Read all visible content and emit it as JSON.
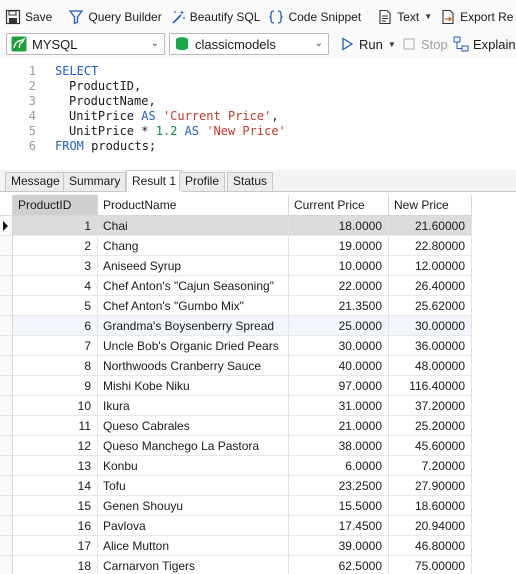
{
  "toolbar": {
    "save": "Save",
    "query_builder": "Query Builder",
    "beautify_sql": "Beautify SQL",
    "code_snippet": "Code Snippet",
    "text": "Text",
    "export": "Export Re"
  },
  "connection": {
    "server": "MYSQL",
    "database": "classicmodels",
    "run": "Run",
    "stop": "Stop",
    "explain": "Explain"
  },
  "editor": {
    "lines": [
      "1",
      "2",
      "3",
      "4",
      "5",
      "6"
    ],
    "l1": "SELECT",
    "l2": "ProductID,",
    "l3": "ProductName,",
    "l4_a": "UnitPrice ",
    "l4_b": "AS",
    "l4_c": "'Current Price'",
    "l4_d": ",",
    "l5_a": "UnitPrice * ",
    "l5_b": "1.2",
    "l5_c": "AS",
    "l5_d": "'New Price'",
    "l6_a": "FROM",
    "l6_b": " products;"
  },
  "tabs": {
    "message": "Message",
    "summary": "Summary",
    "result": "Result 1",
    "profile": "Profile",
    "status": "Status"
  },
  "results": {
    "columns": [
      "ProductID",
      "ProductName",
      "Current Price",
      "New Price"
    ],
    "rows": [
      [
        "1",
        "Chai",
        "18.0000",
        "21.60000"
      ],
      [
        "2",
        "Chang",
        "19.0000",
        "22.80000"
      ],
      [
        "3",
        "Aniseed Syrup",
        "10.0000",
        "12.00000"
      ],
      [
        "4",
        "Chef Anton's \"Cajun Seasoning\"",
        "22.0000",
        "26.40000"
      ],
      [
        "5",
        "Chef Anton's \"Gumbo Mix\"",
        "21.3500",
        "25.62000"
      ],
      [
        "6",
        "Grandma's Boysenberry Spread",
        "25.0000",
        "30.00000"
      ],
      [
        "7",
        "Uncle Bob's Organic Dried Pears",
        "30.0000",
        "36.00000"
      ],
      [
        "8",
        "Northwoods Cranberry Sauce",
        "40.0000",
        "48.00000"
      ],
      [
        "9",
        "Mishi Kobe Niku",
        "97.0000",
        "116.40000"
      ],
      [
        "10",
        "Ikura",
        "31.0000",
        "37.20000"
      ],
      [
        "11",
        "Queso Cabrales",
        "21.0000",
        "25.20000"
      ],
      [
        "12",
        "Queso Manchego La Pastora",
        "38.0000",
        "45.60000"
      ],
      [
        "13",
        "Konbu",
        "6.0000",
        "7.20000"
      ],
      [
        "14",
        "Tofu",
        "23.2500",
        "27.90000"
      ],
      [
        "15",
        "Genen Shouyu",
        "15.5000",
        "18.60000"
      ],
      [
        "16",
        "Pavlova",
        "17.4500",
        "20.94000"
      ],
      [
        "17",
        "Alice Mutton",
        "39.0000",
        "46.80000"
      ],
      [
        "18",
        "Carnarvon Tigers",
        "62.5000",
        "75.00000"
      ]
    ]
  },
  "colors": {
    "selected_row": "#dcdcdc",
    "alt_row": "#f3f7fd"
  }
}
